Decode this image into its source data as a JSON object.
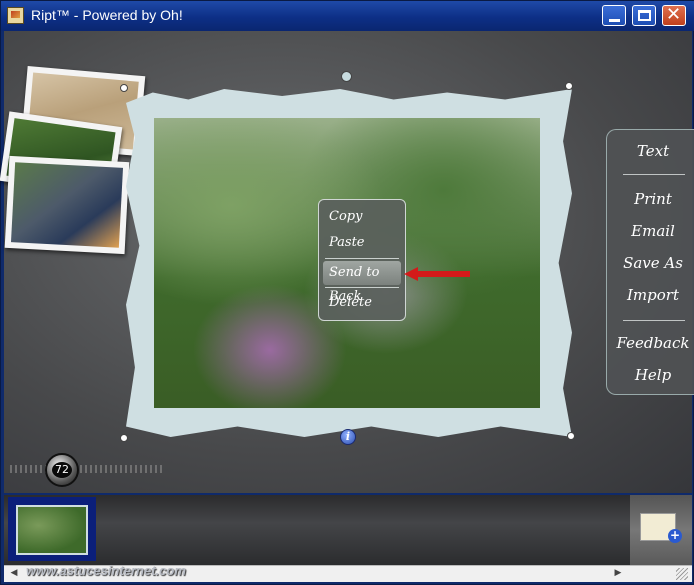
{
  "window": {
    "title": "Ript™ - Powered by Oh!"
  },
  "context_menu": {
    "items": [
      {
        "label": "Copy"
      },
      {
        "label": "Paste"
      },
      {
        "label": "Send to Back",
        "highlighted": true
      },
      {
        "label": "Delete"
      }
    ]
  },
  "side_panel": {
    "items": [
      {
        "label": "Text"
      },
      {
        "label": "Print"
      },
      {
        "label": "Email"
      },
      {
        "label": "Save As"
      },
      {
        "label": "Import"
      },
      {
        "label": "Feedback"
      },
      {
        "label": "Help"
      }
    ]
  },
  "zoom": {
    "value": "72"
  },
  "watermark": "www.astucesinternet.com",
  "colors": {
    "arrow": "#d41a1a",
    "highlight": "#8d938f",
    "thumb_selected": "#0b1f7a"
  }
}
